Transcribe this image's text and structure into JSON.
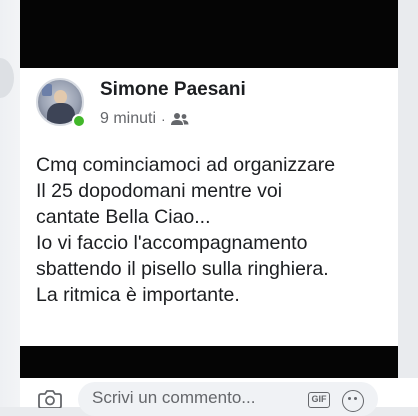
{
  "post": {
    "author_name": "Simone Paesani",
    "timestamp": "9 minuti",
    "separator": "·",
    "audience_icon": "friends-icon",
    "online": true,
    "lines": [
      "Cmq cominciamoci ad organizzare",
      "Il 25 dopodomani mentre voi",
      "cantate Bella Ciao...",
      "Io vi faccio l'accompagnamento",
      "sbattendo il pisello sulla ringhiera.",
      "La ritmica è importante."
    ]
  },
  "comment_bar": {
    "placeholder": "Scrivi un commento...",
    "camera_icon": "camera-icon",
    "gif_label": "GIF",
    "emoji_icon": "emoji-icon"
  },
  "colors": {
    "name": "#1c1e21",
    "meta": "#65676b",
    "online_dot": "#42b72a",
    "redaction": "#050505"
  }
}
